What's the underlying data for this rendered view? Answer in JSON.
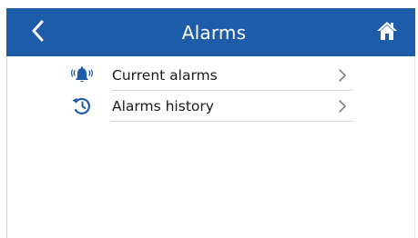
{
  "header": {
    "title": "Alarms",
    "back_icon": "chevron-left-icon",
    "home_icon": "home-icon",
    "background": "#1d5ca9"
  },
  "menu": {
    "items": [
      {
        "label": "Current alarms",
        "icon": "ringing-bell-icon",
        "chevron": "chevron-right-icon"
      },
      {
        "label": "Alarms history",
        "icon": "history-clock-icon",
        "chevron": "chevron-right-icon"
      }
    ]
  }
}
